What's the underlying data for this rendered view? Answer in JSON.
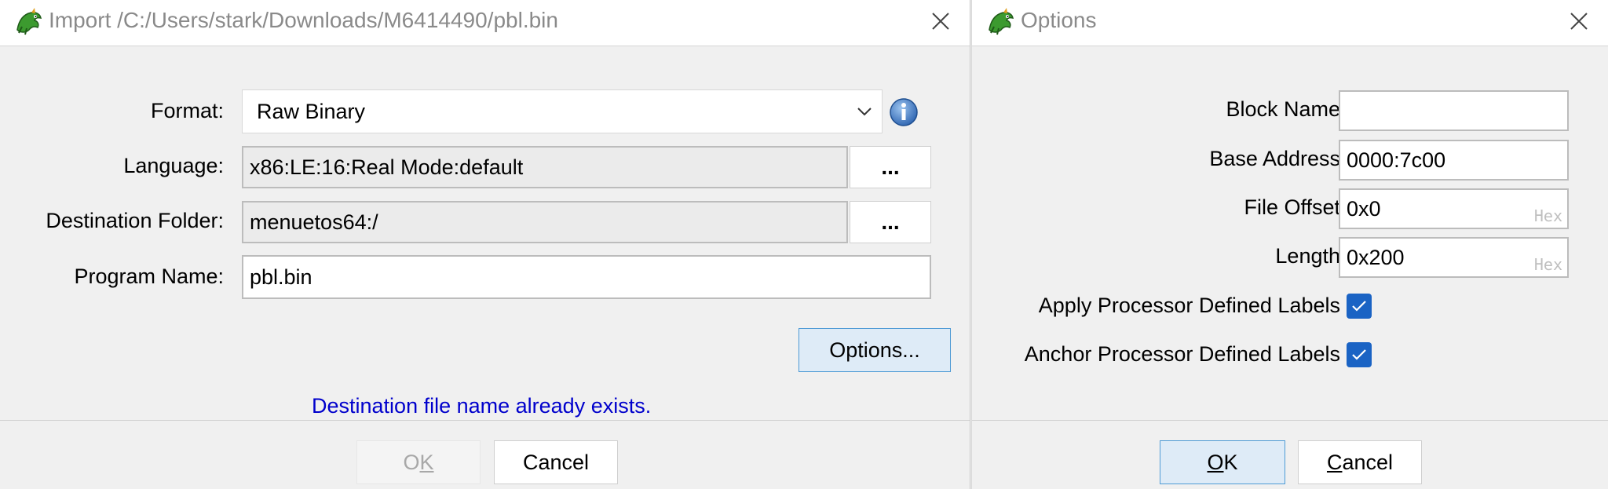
{
  "import_dialog": {
    "title": "Import /C:/Users/stark/Downloads/M6414490/pbl.bin",
    "format": {
      "label": "Format:",
      "value": "Raw Binary"
    },
    "language": {
      "label": "Language:",
      "value": "x86:LE:16:Real Mode:default",
      "browse_label": "..."
    },
    "destination": {
      "label": "Destination Folder:",
      "value": "menuetos64:/",
      "browse_label": "..."
    },
    "program_name": {
      "label": "Program Name:",
      "value": "pbl.bin"
    },
    "options_button": "Options...",
    "status_message": "Destination file name already exists.",
    "ok_pre": "O",
    "ok_mnemonic": "K",
    "cancel_label": "Cancel"
  },
  "options_dialog": {
    "title": "Options",
    "block_name": {
      "label": "Block Name",
      "value": ""
    },
    "base_address": {
      "label": "Base Address",
      "value": "0000:7c00"
    },
    "file_offset": {
      "label": "File Offset",
      "value": "0x0",
      "hint": "Hex"
    },
    "length": {
      "label": "Length",
      "value": "0x200",
      "hint": "Hex"
    },
    "apply_labels": {
      "label": "Apply Processor Defined Labels",
      "checked": true
    },
    "anchor_labels": {
      "label": "Anchor Processor Defined Labels",
      "checked": true
    },
    "ok_mnemonic": "O",
    "ok_post": "K",
    "cancel_mnemonic": "C",
    "cancel_post": "ancel"
  },
  "colors": {
    "status_text": "#0000cc",
    "checkbox": "#1a63c4",
    "focus_button": "#deebf7"
  }
}
